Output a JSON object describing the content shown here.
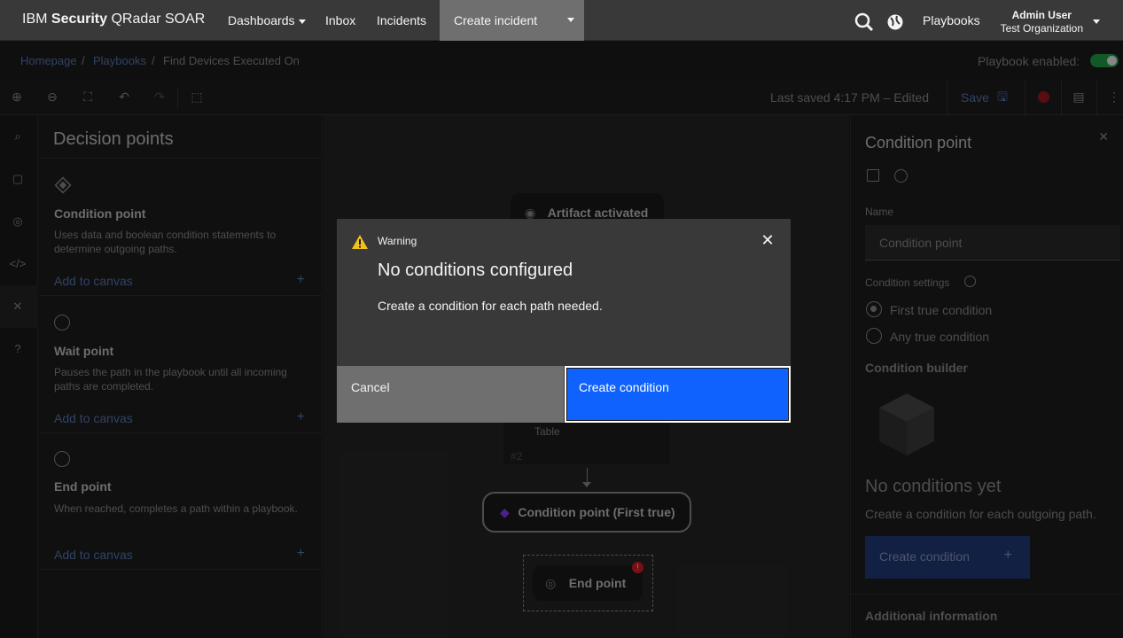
{
  "header": {
    "brand_prefix": "IBM ",
    "brand_bold": "Security",
    "brand_suffix": " QRadar SOAR",
    "nav": [
      "Dashboards",
      "Inbox",
      "Incidents",
      "Create incident"
    ],
    "playbooks_link": "Playbooks",
    "user_name": "Admin User",
    "user_org": "Test Organization"
  },
  "breadcrumb": {
    "items": [
      "Homepage",
      "Playbooks",
      "Find Devices Executed On"
    ],
    "separator": "/",
    "playbook_enabled_label": "Playbook enabled:"
  },
  "toolbar": {
    "last_saved": "Last saved 4:17 PM – Edited",
    "save_label": "Save"
  },
  "left_panel": {
    "title": "Decision points",
    "points": [
      {
        "name": "Condition point",
        "desc": "Uses data and boolean condition statements to determine outgoing paths.",
        "add": "Add to canvas"
      },
      {
        "name": "Wait point",
        "desc": "Pauses the path in the playbook until all incoming paths are completed.",
        "add": "Add to canvas"
      },
      {
        "name": "End point",
        "desc": "When reached, completes a path within a playbook.",
        "add": "Add to canvas"
      }
    ],
    "plus": "+"
  },
  "canvas": {
    "artifact_node": "Artifact activated",
    "table_text": "Table",
    "step_num": "#2",
    "condition_node": "Condition point (First true)",
    "end_node": "End point"
  },
  "right_panel": {
    "title": "Condition point",
    "name_label": "Name",
    "name_value": "Condition point",
    "settings_label": "Condition settings",
    "option_first": "First true condition",
    "option_any": "Any true condition",
    "builder_label": "Condition builder",
    "empty_title": "No conditions yet",
    "empty_desc": "Create a condition for each outgoing path.",
    "create_button": "Create condition",
    "create_plus": "+",
    "additional": "Additional information"
  },
  "modal": {
    "label": "Warning",
    "title": "No conditions configured",
    "body": "Create a condition for each path needed.",
    "cancel": "Cancel",
    "confirm": "Create condition"
  },
  "colors": {
    "primary": "#0f62fe",
    "header_bg": "#393939",
    "warning": "#f1c21b",
    "error": "#da1e28"
  }
}
